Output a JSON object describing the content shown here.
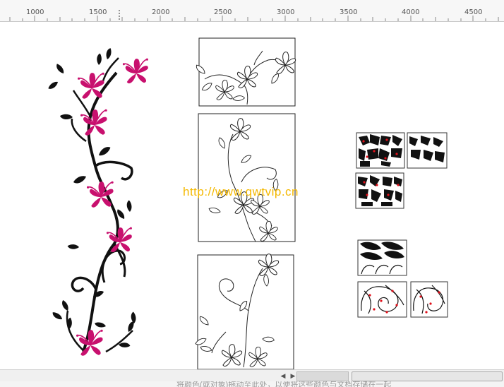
{
  "ruler": {
    "ticks": [
      "1000",
      "1500",
      "2000",
      "2500",
      "3000",
      "3500",
      "4000",
      "4500"
    ]
  },
  "canvas": {
    "watermark": "http://www.qwtvip.cn",
    "colors": {
      "petal": "#c8106e",
      "leaf": "#111111",
      "marker": "#e0101a",
      "watermark": "#f4b800"
    },
    "designs": [
      {
        "name": "flower-vine-color"
      },
      {
        "name": "outline-panel-top"
      },
      {
        "name": "outline-panel-middle"
      },
      {
        "name": "outline-panel-bottom"
      },
      {
        "name": "leaf-pattern-tiles"
      },
      {
        "name": "swirl-pattern-tiles"
      }
    ]
  },
  "status": {
    "text": "将颜色(或对象)拖动至此处，以便将这些颜色与文档存储在一起"
  },
  "scrollbar": {
    "left_arrow": "◀",
    "right_arrow": "▶"
  }
}
